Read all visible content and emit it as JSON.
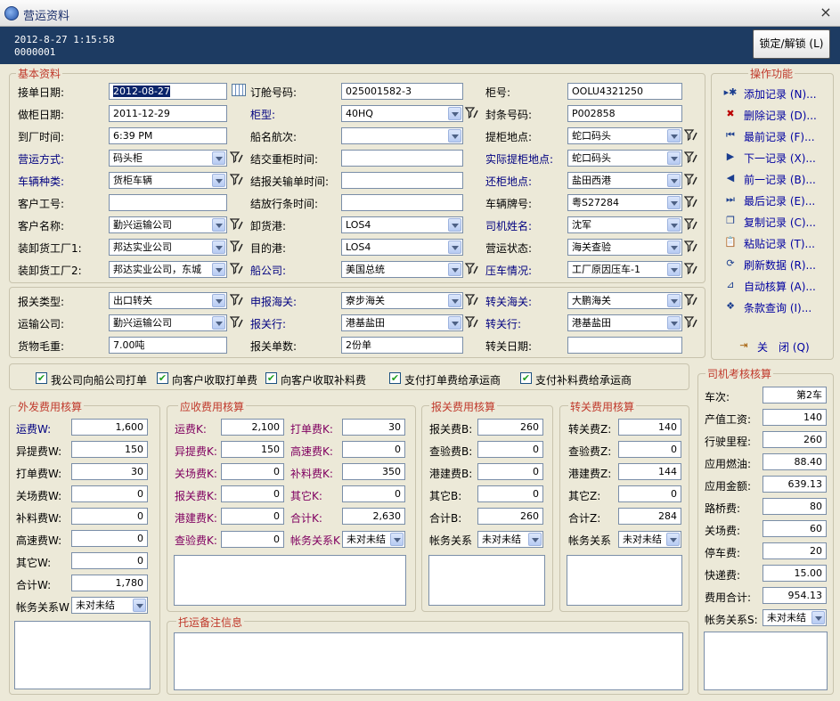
{
  "window": {
    "title": "营运资料",
    "close_label": "×"
  },
  "header": {
    "datetime": "2012-8-27  1:15:58",
    "code": "0000001",
    "lock_button": "锁定/解锁 (L)"
  },
  "basic": {
    "title": "基本资料",
    "col1": [
      {
        "label": "接单日期:",
        "value": "2012-08-27"
      },
      {
        "label": "做柜日期:",
        "value": "2011-12-29"
      },
      {
        "label": "到厂时间:",
        "value": "6:39 PM"
      },
      {
        "label": "营运方式:",
        "value": "码头柜"
      },
      {
        "label": "车辆种类:",
        "value": "货柜车辆"
      },
      {
        "label": "客户工号:",
        "value": ""
      },
      {
        "label": "客户名称:",
        "value": "勤兴运输公司"
      },
      {
        "label": "装卸货工厂1:",
        "value": "邦达实业公司"
      },
      {
        "label": "装卸货工厂2:",
        "value": "邦达实业公司，东城"
      }
    ],
    "col2": [
      {
        "label": "订舱号码:",
        "value": "025001582-3"
      },
      {
        "label": "柜型:",
        "value": "40HQ"
      },
      {
        "label": "船名航次:",
        "value": ""
      },
      {
        "label": "结交重柜时间:",
        "value": ""
      },
      {
        "label": "结报关输单时间:",
        "value": ""
      },
      {
        "label": "结放行条时间:",
        "value": ""
      },
      {
        "label": "卸货港:",
        "value": "LOS4"
      },
      {
        "label": "目的港:",
        "value": "LOS4"
      },
      {
        "label": "船公司:",
        "value": "美国总统"
      }
    ],
    "col3": [
      {
        "label": "柜号:",
        "value": "OOLU4321250"
      },
      {
        "label": "封条号码:",
        "value": "P002858"
      },
      {
        "label": "提柜地点:",
        "value": "蛇口码头"
      },
      {
        "label": "实际提柜地点:",
        "value": "蛇口码头"
      },
      {
        "label": "还柜地点:",
        "value": "盐田西港"
      },
      {
        "label": "车辆牌号:",
        "value": "粤S27284"
      },
      {
        "label": "司机姓名:",
        "value": "沈军"
      },
      {
        "label": "营运状态:",
        "value": "海关查验"
      },
      {
        "label": "压车情况:",
        "value": "工厂原因压车-1"
      }
    ]
  },
  "customs": {
    "row1": [
      {
        "label": "报关类型:",
        "value": "出口转关"
      },
      {
        "label": "申报海关:",
        "value": "寮步海关"
      },
      {
        "label": "转关海关:",
        "value": "大鹏海关"
      }
    ],
    "row2": [
      {
        "label": "运输公司:",
        "value": "勤兴运输公司"
      },
      {
        "label": "报关行:",
        "value": "港基盐田"
      },
      {
        "label": "转关行:",
        "value": "港基盐田"
      }
    ],
    "row3": [
      {
        "label": "货物毛重:",
        "value": "7.00吨"
      },
      {
        "label": "报关单数:",
        "value": "2份单"
      },
      {
        "label": "转关日期:",
        "value": ""
      }
    ]
  },
  "ops": {
    "title": "操作功能",
    "items": [
      "添加记录 (N)...",
      "删除记录 (D)...",
      "最前记录 (F)...",
      "下一记录 (X)...",
      "前一记录 (B)...",
      "最后记录 (E)...",
      "复制记录 (C)...",
      "粘贴记录 (T)...",
      "刷新数据 (R)...",
      "自动核算 (A)...",
      "条款查询 (I)..."
    ],
    "close": "关　闭 (Q)"
  },
  "checks": [
    "我公司向船公司打单",
    "向客户收取打单费",
    "向客户收取补料费",
    "支付打单费给承运商",
    "支付补料费给承运商"
  ],
  "outfee": {
    "title": "外发费用核算",
    "rows": [
      {
        "label": "运费W:",
        "value": "1,600"
      },
      {
        "label": "异提费W:",
        "value": "150"
      },
      {
        "label": "打单费W:",
        "value": "30"
      },
      {
        "label": "关场费W:",
        "value": "0"
      },
      {
        "label": "补料费W:",
        "value": "0"
      },
      {
        "label": "高速费W:",
        "value": "0"
      },
      {
        "label": "其它W:",
        "value": "0"
      },
      {
        "label": "合计W:",
        "value": "1,780"
      }
    ],
    "acct_label": "帐务关系W",
    "acct_value": "未对未结"
  },
  "recv": {
    "title": "应收费用核算",
    "left": [
      {
        "label": "运费K:",
        "value": "2,100"
      },
      {
        "label": "异提费K:",
        "value": "150"
      },
      {
        "label": "关场费K:",
        "value": "0"
      },
      {
        "label": "报关费K:",
        "value": "0"
      },
      {
        "label": "港建费K:",
        "value": "0"
      },
      {
        "label": "查验费K:",
        "value": "0"
      }
    ],
    "right": [
      {
        "label": "打单费K:",
        "value": "30"
      },
      {
        "label": "高速费K:",
        "value": "0"
      },
      {
        "label": "补料费K:",
        "value": "350"
      },
      {
        "label": "其它K:",
        "value": "0"
      },
      {
        "label": "合计K:",
        "value": "2,630"
      }
    ],
    "acct_label": "帐务关系K",
    "acct_value": "未对未结"
  },
  "cust": {
    "title": "报关费用核算",
    "rows": [
      {
        "label": "报关费B:",
        "value": "260"
      },
      {
        "label": "查验费B:",
        "value": "0"
      },
      {
        "label": "港建费B:",
        "value": "0"
      },
      {
        "label": "其它B:",
        "value": "0"
      },
      {
        "label": "合计B:",
        "value": "260"
      }
    ],
    "acct_label": "帐务关系",
    "acct_value": "未对未结"
  },
  "trans": {
    "title": "转关费用核算",
    "rows": [
      {
        "label": "转关费Z:",
        "value": "140"
      },
      {
        "label": "查验费Z:",
        "value": "0"
      },
      {
        "label": "港建费Z:",
        "value": "144"
      },
      {
        "label": "其它Z:",
        "value": "0"
      },
      {
        "label": "合计Z:",
        "value": "284"
      }
    ],
    "acct_label": "帐务关系",
    "acct_value": "未对未结"
  },
  "driver": {
    "title": "司机考核核算",
    "rows": [
      {
        "label": "车次:",
        "value": "第2车"
      },
      {
        "label": "产值工资:",
        "value": "140"
      },
      {
        "label": "行驶里程:",
        "value": "260"
      },
      {
        "label": "应用燃油:",
        "value": "88.40"
      },
      {
        "label": "应用金额:",
        "value": "639.13"
      },
      {
        "label": "路桥费:",
        "value": "80"
      },
      {
        "label": "关场费:",
        "value": "60"
      },
      {
        "label": "停车费:",
        "value": "20"
      },
      {
        "label": "快递费:",
        "value": "15.00"
      },
      {
        "label": "费用合计:",
        "value": "954.13"
      }
    ],
    "acct_label": "帐务关系S:",
    "acct_value": "未对未结"
  },
  "remark": {
    "title": "托运备注信息"
  }
}
